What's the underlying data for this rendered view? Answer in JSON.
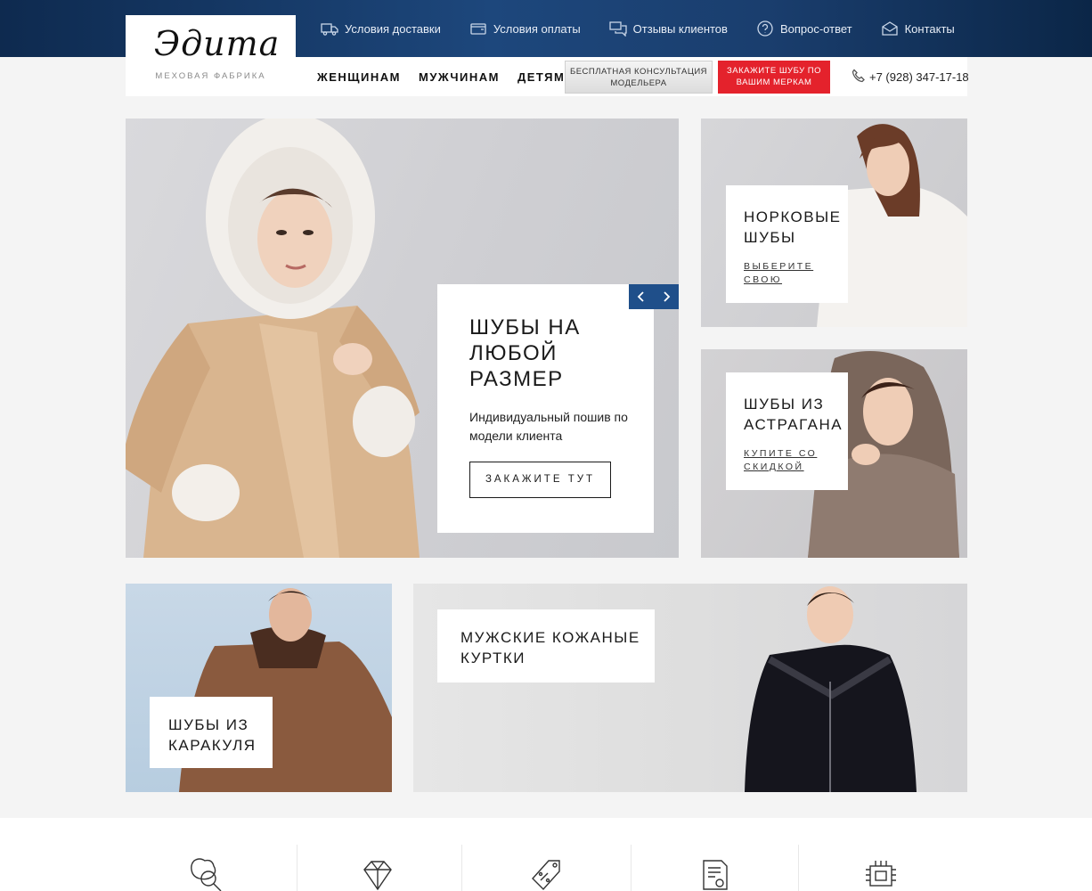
{
  "topbar": {
    "links": [
      {
        "label": "Условия доставки",
        "icon": "truck-icon"
      },
      {
        "label": "Условия оплаты",
        "icon": "wallet-icon"
      },
      {
        "label": "Отзывы клиентов",
        "icon": "chat-icon"
      },
      {
        "label": "Вопрос-ответ",
        "icon": "question-icon"
      },
      {
        "label": "Контакты",
        "icon": "envelope-icon"
      }
    ]
  },
  "logo": {
    "word": "Эдита",
    "subtitle": "МЕХОВАЯ ФАБРИКА"
  },
  "nav": {
    "items": [
      "ЖЕНЩИНАМ",
      "МУЖЧИНАМ",
      "ДЕТЯМ"
    ]
  },
  "buttons": {
    "consult": "БЕСПЛАТНАЯ КОНСУЛЬТАЦИЯ МОДЕЛЬЕРА",
    "order": "ЗАКАЖИТЕ ШУБУ ПО ВАШИМ МЕРКАМ"
  },
  "phone": "+7 (928) 347-17-18",
  "hero": {
    "title": "ШУБЫ НА ЛЮБОЙ РАЗМЕР",
    "subtitle": "Индивидуальный пошив по модели клиента",
    "cta": "ЗАКАЖИТЕ ТУТ"
  },
  "tiles": {
    "mink": {
      "title": "НОРКОВЫЕ ШУБЫ",
      "link": "ВЫБЕРИТЕ СВОЮ"
    },
    "astrakhan": {
      "title": "ШУБЫ ИЗ АСТРАГАНА",
      "link": "КУПИТЕ СО СКИДКОЙ"
    },
    "karakul": {
      "title": "ШУБЫ ИЗ КАРАКУЛЯ"
    },
    "men": {
      "title": "МУЖСКИЕ КОЖАНЫЕ КУРТКИ"
    }
  },
  "features": {
    "icons": [
      "leather-magnifier-icon",
      "diamond-icon",
      "discount-tag-icon",
      "certificate-icon",
      "chip-icon"
    ]
  },
  "colors": {
    "accent_blue": "#1f4f8a",
    "accent_red": "#e4222c",
    "topbar": "#163a66"
  }
}
